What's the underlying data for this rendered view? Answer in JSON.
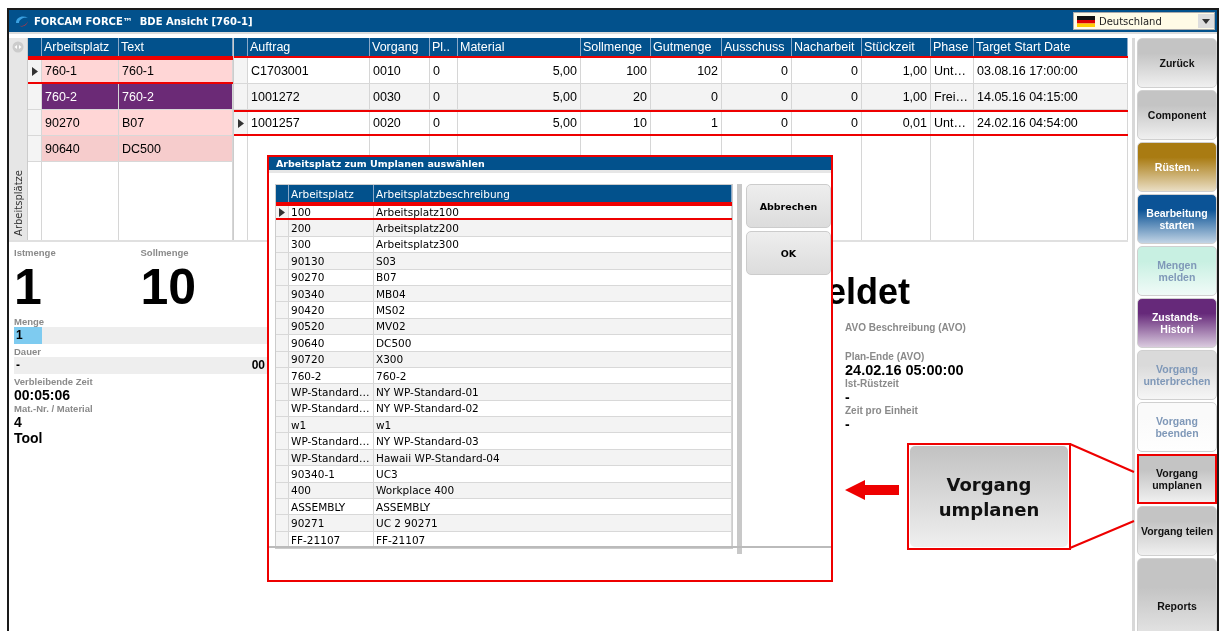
{
  "window": {
    "title": "FORCAM FORCE™  BDE Ansicht [760-1]"
  },
  "language": {
    "value": "Deutschland"
  },
  "side_tab": {
    "label": "Arbeitsplätze"
  },
  "workplaces": {
    "columns": [
      "Arbeitsplatz",
      "Text"
    ],
    "rows": [
      {
        "cells": [
          "760-1",
          "760-1"
        ],
        "selected": true,
        "color": "#ffd6d6"
      },
      {
        "cells": [
          "760-2",
          "760-2"
        ],
        "selected": false,
        "color": "#6b2a76"
      },
      {
        "cells": [
          "90270",
          "B07"
        ],
        "selected": false,
        "color": "#ffd6d6"
      },
      {
        "cells": [
          "90640",
          "DC500"
        ],
        "selected": false,
        "color": "#f6cccc"
      }
    ]
  },
  "orders": {
    "columns": [
      "Auftrag",
      "Vorgang",
      "Pl..",
      "Material",
      "Sollmenge",
      "Gutmenge",
      "Ausschuss",
      "Nacharbeit",
      "Stückzeit",
      "Phase",
      "Target Start Date"
    ],
    "rows": [
      {
        "cells": [
          "C1703001",
          "0010",
          "0",
          "5,00",
          "100",
          "102",
          "0",
          "0",
          "1,00",
          "Unt…",
          "03.08.16 17:00:00"
        ],
        "selected": false
      },
      {
        "cells": [
          "1001272",
          "0030",
          "0",
          "5,00",
          "20",
          "0",
          "0",
          "0",
          "1,00",
          "Frei…",
          "14.05.16 04:15:00"
        ],
        "selected": false
      },
      {
        "cells": [
          "1001257",
          "0020",
          "0",
          "5,00",
          "10",
          "1",
          "0",
          "0",
          "0,01",
          "Unt…",
          "24.02.16 04:54:00"
        ],
        "selected": true
      }
    ]
  },
  "quantities": [
    {
      "label": "Istmenge",
      "value": "1"
    },
    {
      "label": "Sollmenge",
      "value": "10"
    }
  ],
  "status_text": "eldet",
  "fields_left": [
    {
      "kind": "field",
      "label": "Menge",
      "value": "1",
      "highlighted": true
    },
    {
      "kind": "field",
      "label": "Dauer",
      "value": "-",
      "value_end": "00",
      "highlighted": false
    },
    {
      "kind": "text",
      "label": "Verbleibende Zeit",
      "lines": [
        "00:05:06"
      ]
    },
    {
      "kind": "text",
      "label": "Mat.-Nr. / Material",
      "lines": [
        "4",
        "Tool"
      ]
    }
  ],
  "fields_right": [
    {
      "label": "AVO Beschreibung (AVO)"
    },
    {
      "label": "Plan-Ende (AVO)",
      "lines": [
        "24.02.16 05:00:00"
      ]
    },
    {
      "label": "Ist-Rüstzeit",
      "lines": [
        "-"
      ]
    },
    {
      "label": "Zeit pro Einheit",
      "lines": [
        "-"
      ]
    }
  ],
  "dialog": {
    "title": "Arbeitsplatz zum Umplanen auswählen",
    "columns": [
      "Arbeitsplatz",
      "Arbeitsplatzbeschreibung"
    ],
    "rows": [
      {
        "cells": [
          "100",
          "Arbeitsplatz100"
        ],
        "selected": true
      },
      {
        "cells": [
          "200",
          "Arbeitsplatz200"
        ],
        "selected": false
      },
      {
        "cells": [
          "300",
          "Arbeitsplatz300"
        ],
        "selected": false
      },
      {
        "cells": [
          "90130",
          "S03"
        ],
        "selected": false
      },
      {
        "cells": [
          "90270",
          "B07"
        ],
        "selected": false
      },
      {
        "cells": [
          "90340",
          "MB04"
        ],
        "selected": false
      },
      {
        "cells": [
          "90420",
          "MS02"
        ],
        "selected": false
      },
      {
        "cells": [
          "90520",
          "MV02"
        ],
        "selected": false
      },
      {
        "cells": [
          "90640",
          "DC500"
        ],
        "selected": false
      },
      {
        "cells": [
          "90720",
          "X300"
        ],
        "selected": false
      },
      {
        "cells": [
          "760-2",
          "760-2"
        ],
        "selected": false
      },
      {
        "cells": [
          "WP-Standard…",
          "NY WP-Standard-01"
        ],
        "selected": false
      },
      {
        "cells": [
          "WP-Standard…",
          "NY WP-Standard-02"
        ],
        "selected": false
      },
      {
        "cells": [
          "w1",
          "w1"
        ],
        "selected": false
      },
      {
        "cells": [
          "WP-Standard…",
          "NY WP-Standard-03"
        ],
        "selected": false
      },
      {
        "cells": [
          "WP-Standard…",
          "Hawaii WP-Standard-04"
        ],
        "selected": false
      },
      {
        "cells": [
          "90340-1",
          "UC3"
        ],
        "selected": false
      },
      {
        "cells": [
          "400",
          "Workplace 400"
        ],
        "selected": false
      },
      {
        "cells": [
          "ASSEMBLY",
          "ASSEMBLY"
        ],
        "selected": false
      },
      {
        "cells": [
          "90271",
          "UC 2 90271"
        ],
        "selected": false
      },
      {
        "cells": [
          "FF-21107",
          "FF-21107"
        ],
        "selected": false
      }
    ],
    "buttons": [
      "Abbrechen",
      "OK"
    ]
  },
  "actions": [
    {
      "label": "Zurück",
      "color": "#c4c4c4",
      "disabled": false,
      "highlighted": false
    },
    {
      "label": "Component",
      "color": "#c4c4c4",
      "disabled": false,
      "highlighted": false
    },
    {
      "label": "Rüsten...",
      "color": "#a97b12",
      "disabled": false,
      "highlighted": false
    },
    {
      "label": "Bearbeitung starten",
      "color": "#0b5396",
      "disabled": false,
      "highlighted": false
    },
    {
      "label": "Mengen melden",
      "color": "#c8f0e2",
      "disabled": true,
      "highlighted": false
    },
    {
      "label": "Zustands-Histori",
      "color": "#66297a",
      "disabled": false,
      "highlighted": false
    },
    {
      "label": "Vorgang unterbrechen",
      "color": "#dadada",
      "disabled": true,
      "highlighted": false
    },
    {
      "label": "Vorgang beenden",
      "color": "#fafafa",
      "disabled": true,
      "highlighted": false
    },
    {
      "label": "Vorgang umplanen",
      "color": "#c4c4c4",
      "disabled": false,
      "highlighted": true
    },
    {
      "label": "Vorgang teilen",
      "color": "#c4c4c4",
      "disabled": false,
      "highlighted": false
    },
    {
      "label": "Reports",
      "color": "#c4c4c4",
      "disabled": false,
      "highlighted": false
    }
  ],
  "callout": {
    "label": "Vorgang umplanen"
  }
}
